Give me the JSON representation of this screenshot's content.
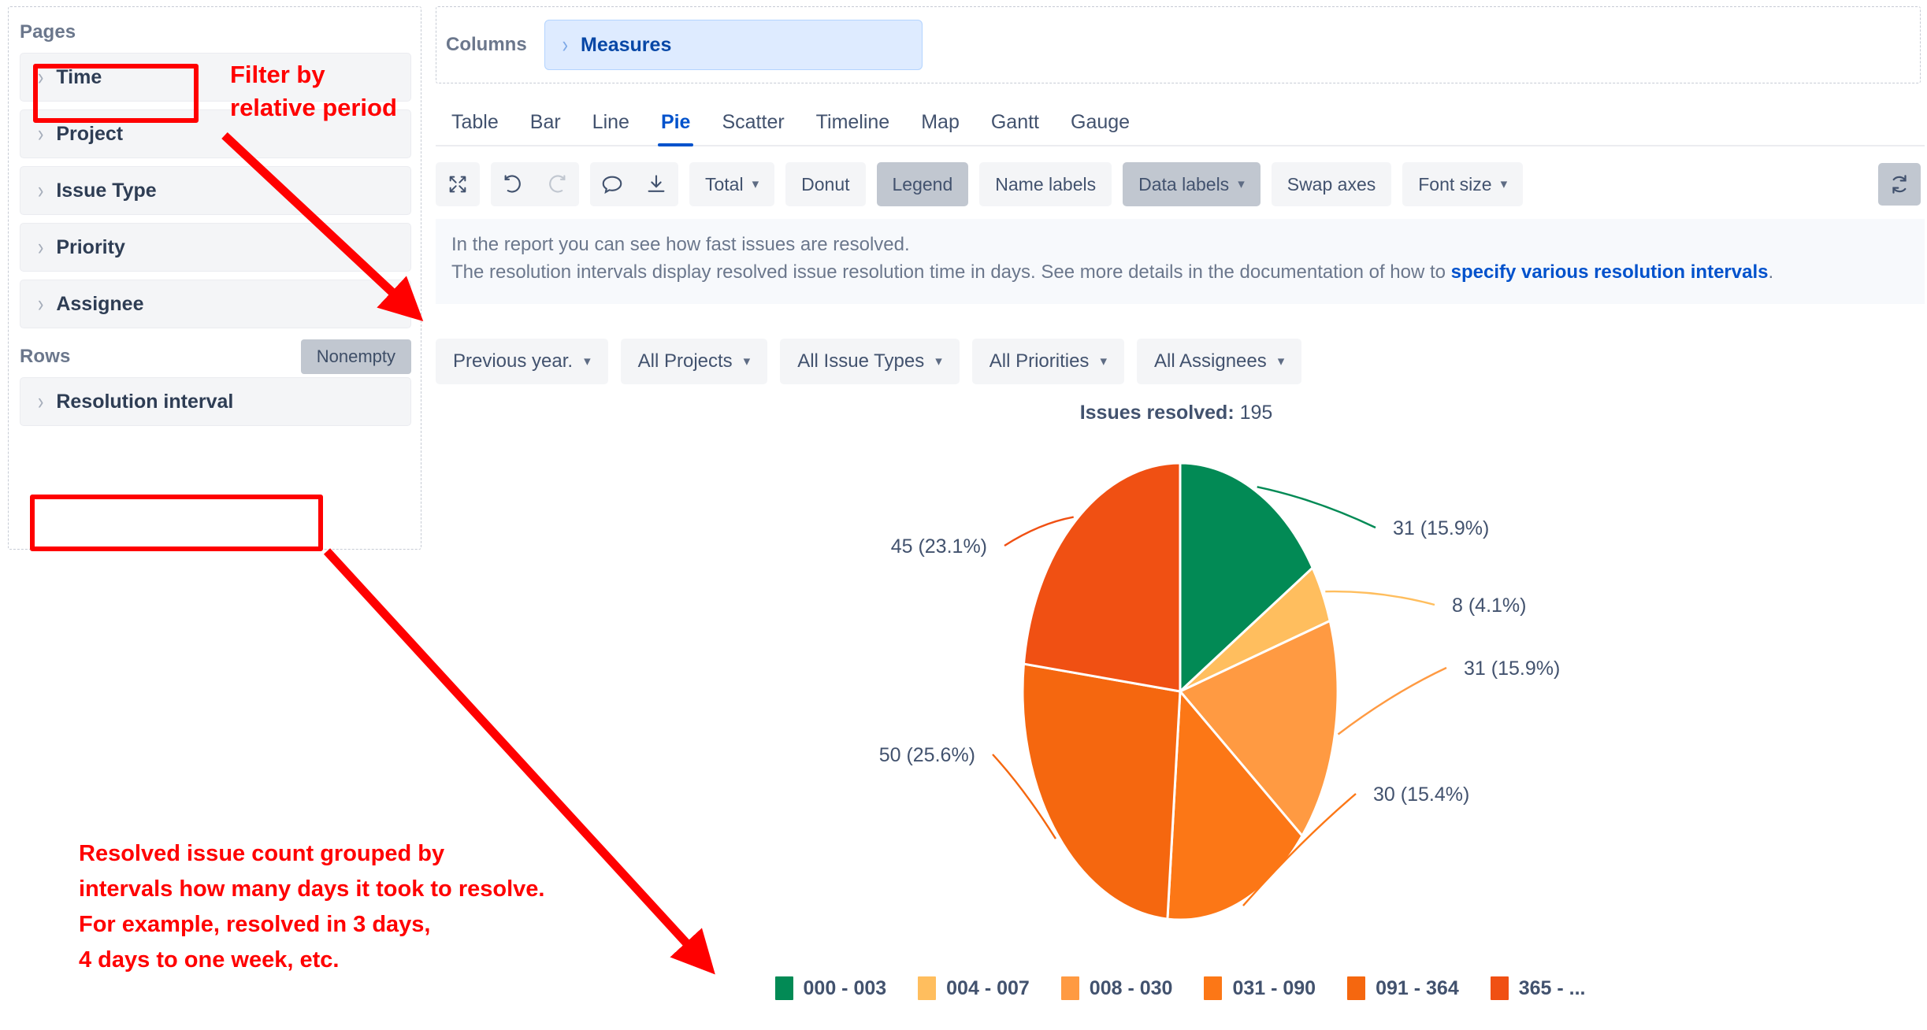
{
  "left_panel": {
    "pages": {
      "title": "Pages",
      "items": [
        {
          "label": "Time"
        },
        {
          "label": "Project"
        },
        {
          "label": "Issue Type"
        },
        {
          "label": "Priority"
        },
        {
          "label": "Assignee"
        }
      ]
    },
    "rows": {
      "title": "Rows",
      "nonempty_label": "Nonempty",
      "items": [
        {
          "label": "Resolution interval"
        }
      ]
    }
  },
  "annotations": {
    "filter_note": "Filter by\nrelative period",
    "resolution_note": "Resolved issue count grouped by\nintervals how many days it took to resolve.\nFor example, resolved in 3 days,\n4 days to one week, etc.",
    "color": "#FF0000"
  },
  "columns_shelf": {
    "label": "Columns",
    "pill_label": "Measures"
  },
  "tabs": [
    {
      "label": "Table",
      "active": false
    },
    {
      "label": "Bar",
      "active": false
    },
    {
      "label": "Line",
      "active": false
    },
    {
      "label": "Pie",
      "active": true
    },
    {
      "label": "Scatter",
      "active": false
    },
    {
      "label": "Timeline",
      "active": false
    },
    {
      "label": "Map",
      "active": false
    },
    {
      "label": "Gantt",
      "active": false
    },
    {
      "label": "Gauge",
      "active": false
    }
  ],
  "toolbar": {
    "fullscreen_icon": "expand-icon",
    "undo_icon": "undo-icon",
    "redo_icon": "redo-icon",
    "comment_icon": "comment-icon",
    "download_icon": "download-icon",
    "total_label": "Total",
    "donut_label": "Donut",
    "legend_label": "Legend",
    "name_labels_label": "Name labels",
    "data_labels_label": "Data labels",
    "swap_axes_label": "Swap axes",
    "font_size_label": "Font size",
    "refresh_icon": "refresh-icon",
    "active_color": "#C1C7D0"
  },
  "info_banner": {
    "line1": "In the report you can see how fast issues are resolved.",
    "line2_prefix": "The resolution intervals display resolved issue resolution time in days. See more details in the documentation of how to ",
    "link_text": "specify various resolution intervals",
    "line2_suffix": ".",
    "link_color": "#0052CC"
  },
  "filters": [
    {
      "label": "Previous year."
    },
    {
      "label": "All Projects"
    },
    {
      "label": "All Issue Types"
    },
    {
      "label": "All Priorities"
    },
    {
      "label": "All Assignees"
    }
  ],
  "summary": {
    "label": "Issues resolved",
    "value": "195"
  },
  "chart_data": {
    "type": "pie",
    "title": "Issues resolved: 195",
    "total": 195,
    "categories": [
      "000 - 003",
      "004 - 007",
      "008 - 030",
      "031 - 090",
      "091 - 364",
      "365 - ..."
    ],
    "values": [
      31,
      8,
      31,
      30,
      50,
      45
    ],
    "percent_labels": [
      "31 (15.9%)",
      "8 (4.1%)",
      "31 (15.9%)",
      "30 (15.4%)",
      "50 (25.6%)",
      "45 (23.1%)"
    ],
    "percents": [
      15.9,
      4.1,
      15.9,
      15.4,
      25.6,
      23.1
    ],
    "colors": [
      "#028A55",
      "#FFBE5E",
      "#FF9A42",
      "#FC7716",
      "#F5670F",
      "#F05013"
    ],
    "legend_position": "bottom",
    "donut": false,
    "labels_shown": true,
    "xlabel": "",
    "ylabel": ""
  }
}
